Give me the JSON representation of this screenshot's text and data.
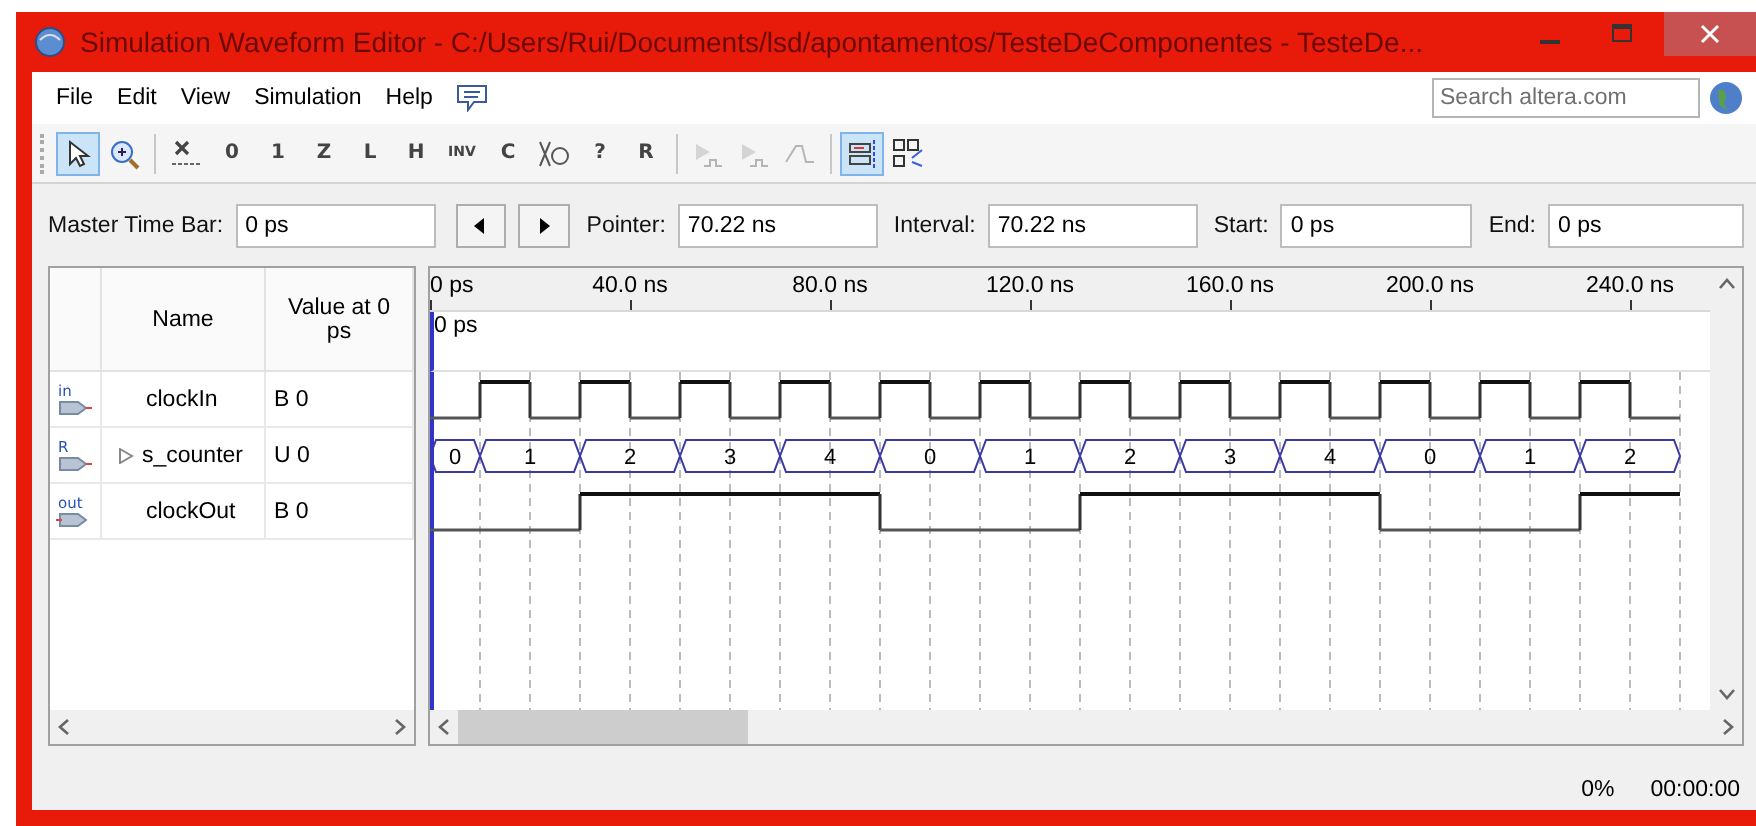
{
  "window": {
    "title": "Simulation Waveform Editor - C:/Users/Rui/Documents/lsd/apontamentos/TesteDeComponentes - TesteDe..."
  },
  "menu": [
    "File",
    "Edit",
    "View",
    "Simulation",
    "Help"
  ],
  "search": {
    "placeholder": "Search altera.com"
  },
  "toolbar": [
    [
      {
        "kind": "pointer",
        "selected": true,
        "disabled": false
      },
      {
        "kind": "zoom",
        "selected": false,
        "disabled": false
      }
    ],
    [
      {
        "kind": "unknown",
        "selected": false,
        "disabled": false
      },
      {
        "kind": "glyph",
        "glyph": "0",
        "selected": false,
        "disabled": false
      },
      {
        "kind": "glyph",
        "glyph": "1",
        "selected": false,
        "disabled": false
      },
      {
        "kind": "glyph",
        "glyph": "Z",
        "selected": false,
        "disabled": false
      },
      {
        "kind": "glyph",
        "glyph": "L",
        "selected": false,
        "disabled": false
      },
      {
        "kind": "glyph",
        "glyph": "H",
        "selected": false,
        "disabled": false
      },
      {
        "kind": "glyph",
        "glyph": "INV",
        "selected": false,
        "disabled": false
      },
      {
        "kind": "glyph",
        "glyph": "C",
        "selected": false,
        "disabled": false
      },
      {
        "kind": "count",
        "selected": false,
        "disabled": false
      },
      {
        "kind": "glyph",
        "glyph": "?",
        "selected": false,
        "disabled": false
      },
      {
        "kind": "glyph",
        "glyph": "R",
        "selected": false,
        "disabled": false
      }
    ],
    [
      {
        "kind": "simulate",
        "selected": false,
        "disabled": true
      },
      {
        "kind": "simulate",
        "selected": false,
        "disabled": true
      },
      {
        "kind": "rise",
        "selected": false,
        "disabled": true
      }
    ],
    [
      {
        "kind": "snap",
        "selected": true,
        "disabled": false
      },
      {
        "kind": "grid",
        "selected": false,
        "disabled": false
      }
    ]
  ],
  "time_bar": {
    "master": {
      "label": "Master Time Bar:",
      "value": "0 ps"
    },
    "fields": [
      {
        "label": "Pointer:",
        "value": "70.22 ns"
      },
      {
        "label": "Interval:",
        "value": "70.22 ns"
      },
      {
        "label": "Start:",
        "value": "0 ps"
      },
      {
        "label": "End:",
        "value": "0 ps"
      }
    ]
  },
  "table": {
    "columns": [
      "Name",
      "Value at 0 ps"
    ]
  },
  "ruler": {
    "ticks": [
      "0 ps",
      "40.0 ns",
      "80.0 ns",
      "120.0 ns",
      "160.0 ns",
      "200.0 ns",
      "240.0 ns"
    ],
    "marker": "0 ps"
  },
  "signals": [
    {
      "kind": "input",
      "icon_label": "in",
      "name": "clockIn",
      "value": "B 0",
      "high": [
        false,
        true,
        false,
        true,
        false,
        true,
        false,
        true,
        false,
        true,
        false,
        true,
        false,
        true,
        false,
        true,
        false,
        true,
        false,
        true,
        false,
        true,
        false,
        true,
        false
      ]
    },
    {
      "kind": "bus",
      "icon_label": "R",
      "name": "s_counter",
      "value": "U 0",
      "expanded": false,
      "values": [
        "0",
        "1",
        "2",
        "3",
        "4",
        "0",
        "1",
        "2",
        "3",
        "4",
        "0",
        "1",
        "2"
      ]
    },
    {
      "kind": "output",
      "icon_label": "out",
      "name": "clockOut",
      "value": "B 0",
      "high": [
        false,
        false,
        false,
        true,
        true,
        true,
        true,
        true,
        true,
        false,
        false,
        false,
        false,
        true,
        true,
        true,
        true,
        true,
        true,
        false,
        false,
        false,
        false,
        true,
        true
      ]
    }
  ],
  "status_bar": {
    "progress": "0%",
    "elapsed": "00:00:00"
  }
}
